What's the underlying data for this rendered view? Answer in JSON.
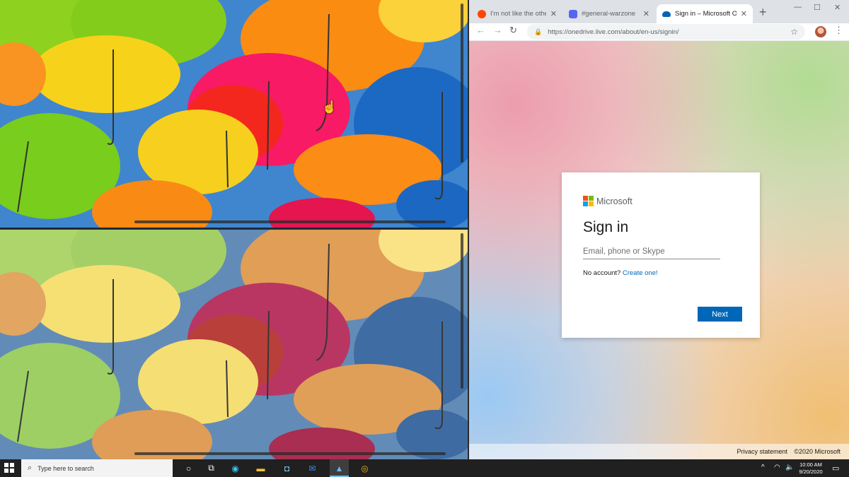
{
  "browser": {
    "tabs": [
      {
        "label": "I'm not like the other girls",
        "favicon_color": "#ff4500",
        "active": false
      },
      {
        "label": "#general-warzone",
        "favicon_color": "#5865f2",
        "active": false
      },
      {
        "label": "Sign in – Microsoft OneDrive",
        "favicon_color": "#0364b8",
        "active": true
      }
    ],
    "url": "https://onedrive.live.com/about/en-us/signin/"
  },
  "signin": {
    "brand": "Microsoft",
    "title": "Sign in",
    "email_placeholder": "Email, phone or Skype",
    "no_account_text": "No account?",
    "create_link": "Create one!",
    "next_button": "Next"
  },
  "footer": {
    "privacy": "Privacy statement",
    "copyright": "©2020 Microsoft"
  },
  "taskbar": {
    "search_placeholder": "Type here to search",
    "time": "10:00 AM",
    "date": "9/20/2020"
  },
  "colors": {
    "ms_red": "#f25022",
    "ms_green": "#7fba00",
    "ms_blue": "#00a4ef",
    "ms_yellow": "#ffb900",
    "accent": "#0067b8"
  }
}
